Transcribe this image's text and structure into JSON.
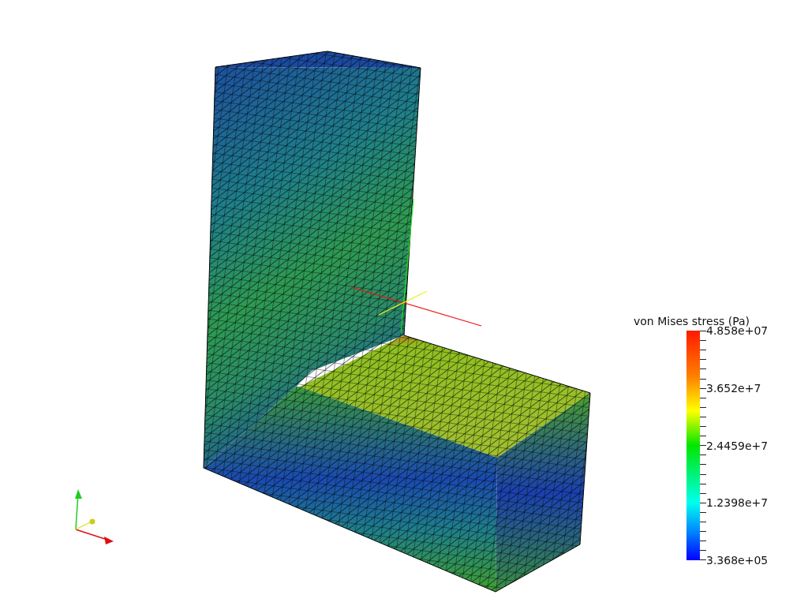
{
  "color_legend": {
    "title": "von Mises stress (Pa)",
    "labels": [
      "4.858e+07",
      "3.652e+7",
      "2.4459e+7",
      "1.2398e+7",
      "3.368e+05"
    ]
  }
}
